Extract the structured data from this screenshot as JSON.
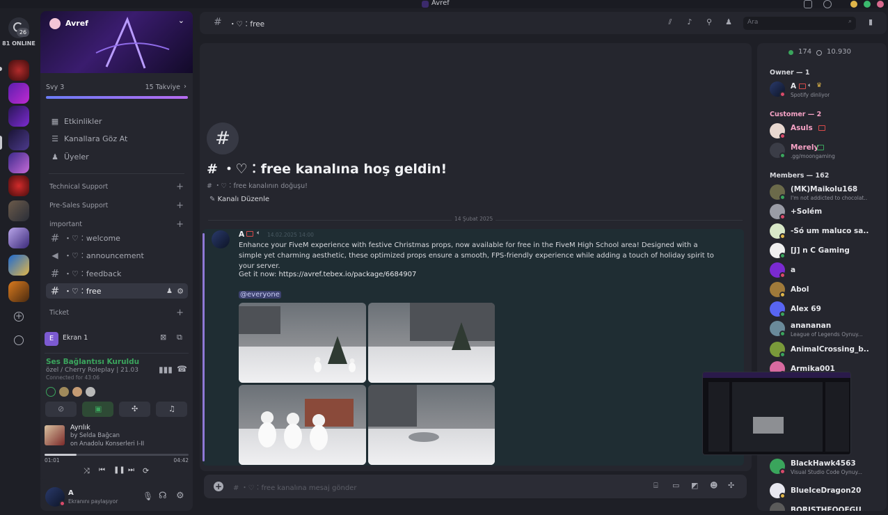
{
  "window": {
    "title": "Avref"
  },
  "rail": {
    "online_count": "81 ONLINE",
    "dm_badge": "26"
  },
  "server": {
    "name": "Avref",
    "boost_level": "Svy 3",
    "boosts": "15 Takviye"
  },
  "menu": [
    {
      "label": "Etkinlikler",
      "icon": "calendar-icon"
    },
    {
      "label": "Kanallara Göz At",
      "icon": "browse-channels-icon"
    },
    {
      "label": "Üyeler",
      "icon": "members-icon"
    }
  ],
  "categories": {
    "technical": "Technical Support",
    "presales": "Pre-Sales Support",
    "important": "important",
    "ticket": "Ticket"
  },
  "channels": [
    {
      "label": "・♡︰welcome",
      "icon": "hash-icon"
    },
    {
      "label": "・♡︰announcement",
      "icon": "announcement-icon"
    },
    {
      "label": "・♡︰feedback",
      "icon": "hash-icon"
    },
    {
      "label": "・♡︰free",
      "icon": "hash-icon"
    }
  ],
  "voice": {
    "stream_name": "Ekran 1",
    "status": "Ses Bağlantısı Kuruldu",
    "channel": "özel / Cherry Roleplay | 21.03",
    "connected": "Connected for 43:06",
    "song": "Ayrılık",
    "artist_prefix": "by",
    "artist": "Selda Bağcan",
    "album_prefix": "on",
    "album": "Anadolu Konserleri I-II",
    "time_current": "01:01",
    "time_total": "04:42",
    "progress": 0.22
  },
  "user": {
    "name": "A",
    "status": "Ekranını paylaşıyor"
  },
  "header": {
    "channel": "・♡︰free",
    "search_placeholder": "Ara"
  },
  "welcome": {
    "title": "# ・♡︰free kanalına hoş geldin!",
    "subtitle": "# ・♡︰free kanalının doğuşu!",
    "edit_label": "Kanalı Düzenle",
    "date_divider": "14 Şubat 2025"
  },
  "message": {
    "author": "A",
    "timestamp": "14.02.2025 14:00",
    "body": "Enhance your FiveM experience with festive Christmas props, now available for free in the FiveM High School area! Designed with a simple yet charming aesthetic, these optimized props ensure a smooth, FPS-friendly experience while adding a touch of holiday spirit to your server.",
    "link_prefix": "Get it now:",
    "link": "https://avref.tebex.io/package/6684907",
    "mention": "@everyone"
  },
  "composer": {
    "placeholder": "# ・♡︰free kanalına mesaj gönder"
  },
  "members_panel": {
    "online": "174",
    "total": "10.930",
    "owner_header": "Owner — 1",
    "customer_header": "Customer — 2",
    "members_header": "Members — 162",
    "owner": [
      {
        "name": "A",
        "status": "Spotify dinliyor",
        "color": "#ffffff"
      }
    ],
    "customers": [
      {
        "name": "Asuls",
        "status": "",
        "color": "#f7a3c6"
      },
      {
        "name": "Merely",
        "status": ".gg/moongaming",
        "color": "#f7a3c6"
      }
    ],
    "members": [
      {
        "name": "(MK)Maikolu168",
        "status": "I'm not addicted to chocolat..."
      },
      {
        "name": "+Solém",
        "status": ""
      },
      {
        "name": "-Só um maluco sa...",
        "status": ""
      },
      {
        "name": "[J] n C Gaming",
        "status": ""
      },
      {
        "name": "a",
        "status": ""
      },
      {
        "name": "Abol",
        "status": ""
      },
      {
        "name": "Alex 69",
        "status": ""
      },
      {
        "name": "anananan",
        "status": "League of Legends Oynuy..."
      },
      {
        "name": "AnimalCrossing_b...",
        "status": ""
      },
      {
        "name": "Armika001",
        "status": ""
      },
      {
        "name": "BlackHawk4563",
        "status": "Visual Studio Code Oynuy..."
      },
      {
        "name": "BlueIceDragon20",
        "status": ""
      },
      {
        "name": "BORISTHEOOFGU...",
        "status": ""
      }
    ]
  },
  "colors": {
    "accent": "#8e78d6",
    "online": "#3aa55c",
    "link": "#e6e7eb",
    "status_green": "#3ba55d"
  }
}
